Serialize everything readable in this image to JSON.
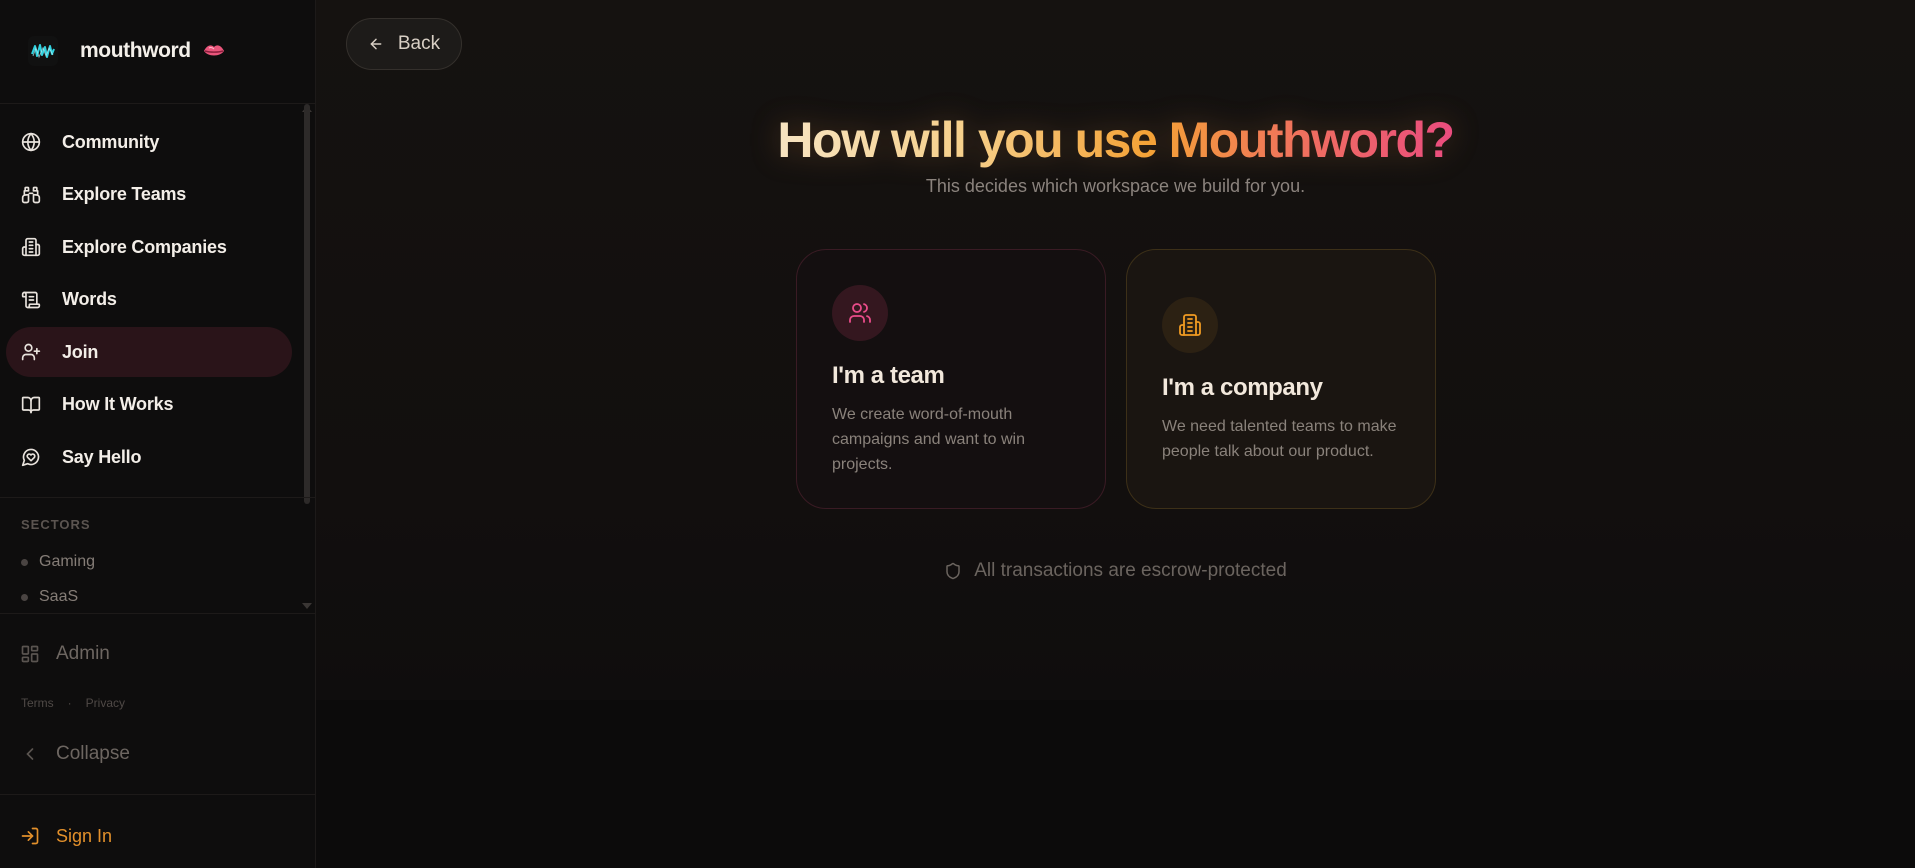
{
  "brand": {
    "name": "mouthword",
    "logo_icon": "waveform-logo-icon",
    "badge_icon": "lips-icon"
  },
  "nav": {
    "items": [
      {
        "label": "Community",
        "icon": "globe-icon"
      },
      {
        "label": "Explore Teams",
        "icon": "binoculars-icon"
      },
      {
        "label": "Explore Companies",
        "icon": "building-icon"
      },
      {
        "label": "Words",
        "icon": "scroll-icon"
      },
      {
        "label": "Join",
        "icon": "user-plus-icon",
        "active": true
      },
      {
        "label": "How It Works",
        "icon": "book-open-icon"
      },
      {
        "label": "Say Hello",
        "icon": "message-heart-icon"
      }
    ]
  },
  "sectors": {
    "title": "SECTORS",
    "items": [
      "Gaming",
      "SaaS"
    ]
  },
  "footer": {
    "admin_label": "Admin",
    "terms_label": "Terms",
    "legal_separator": "·",
    "privacy_label": "Privacy",
    "collapse_label": "Collapse",
    "signin_label": "Sign In"
  },
  "main": {
    "back_label": "Back",
    "headline": "How will you use Mouthword?",
    "subline": "This decides which workspace we build for you.",
    "cards": {
      "team": {
        "title": "I'm a team",
        "description": "We create word-of-mouth campaigns and want to win projects.",
        "icon": "users-icon"
      },
      "company": {
        "title": "I'm a company",
        "description": "We need talented teams to make people talk about our product.",
        "icon": "building-icon"
      }
    },
    "escrow_note": "All transactions are escrow-protected",
    "escrow_icon": "shield-icon"
  },
  "colors": {
    "accent_orange": "#e3902b",
    "accent_pink": "#ea4c8a",
    "active_nav_bg": "#2a1419"
  }
}
